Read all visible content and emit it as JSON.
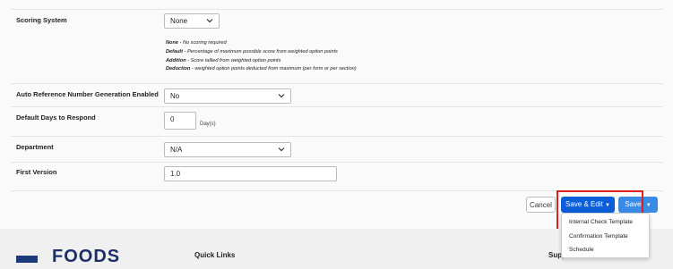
{
  "form": {
    "scoring": {
      "label": "Scoring System",
      "value": "None",
      "help": [
        {
          "term": "None",
          "desc": " - No scoring required"
        },
        {
          "term": "Default",
          "desc": " - Percentage of maximum possible score from weighted option points"
        },
        {
          "term": "Addition",
          "desc": " - Score tallied from weighted option points"
        },
        {
          "term": "Deduction",
          "desc": " - weighted option points deducted from maximum (per form or per section)"
        }
      ]
    },
    "auto_ref": {
      "label": "Auto Reference Number Generation Enabled",
      "value": "No"
    },
    "days": {
      "label": "Default Days to Respond",
      "value": "0",
      "unit": "Day(s)"
    },
    "department": {
      "label": "Department",
      "value": "N/A"
    },
    "version": {
      "label": "First Version",
      "value": "1.0"
    }
  },
  "actions": {
    "cancel": "Cancel",
    "save_edit": "Save & Edit",
    "save": "Save"
  },
  "dropdown_menu": {
    "items": [
      "Internal Check Template",
      "Confirmation Template",
      "Schedule"
    ]
  },
  "footer": {
    "logo_text": "FOODS",
    "quick_links": "Quick Links",
    "support": "Support"
  },
  "colors": {
    "primary": "#0b5ed7",
    "highlight": "#e0201b"
  }
}
